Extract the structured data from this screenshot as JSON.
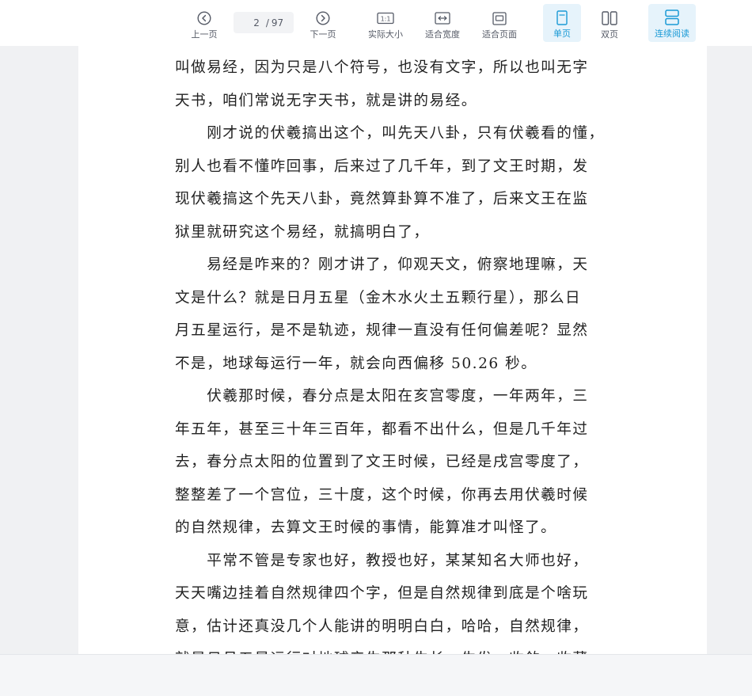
{
  "toolbar": {
    "prev_label": "上一页",
    "next_label": "下一页",
    "current_page": "2",
    "page_separator": "/",
    "total_pages": "97",
    "actual_size_label": "实际大小",
    "actual_size_icon_text": "1:1",
    "fit_width_label": "适合宽度",
    "fit_page_label": "适合页面",
    "single_page_label": "单页",
    "double_page_label": "双页",
    "continuous_label": "连续阅读",
    "accent_color": "#1a9ad6"
  },
  "document": {
    "lines": [
      "叫做易经，因为只是八个符号，也没有文字，所以也叫无字",
      "天书，咱们常说无字天书，就是讲的易经。",
      "　　刚才说的伏羲搞出这个，叫先天八卦，只有伏羲看的懂，",
      "别人也看不懂咋回事，后来过了几千年，到了文王时期，发",
      "现伏羲搞这个先天八卦，竟然算卦算不准了，后来文王在监",
      "狱里就研究这个易经，就搞明白了，",
      "　　易经是咋来的？刚才讲了，仰观天文，俯察地理嘛，天",
      "文是什么？就是日月五星（金木水火土五颗行星），那么日",
      "月五星运行，是不是轨迹，规律一直没有任何偏差呢？显然",
      "不是，地球每运行一年，就会向西偏移 50.26 秒。",
      "　　伏羲那时候，春分点是太阳在亥宫零度，一年两年，三",
      "年五年，甚至三十年三百年，都看不出什么，但是几千年过",
      "去，春分点太阳的位置到了文王时候，已经是戌宫零度了，",
      "整整差了一个宫位，三十度，这个时候，你再去用伏羲时候",
      "的自然规律，去算文王时候的事情，能算准才叫怪了。",
      "　　平常不管是专家也好，教授也好，某某知名大师也好，",
      "天天嘴边挂着自然规律四个字，但是自然规律到底是个啥玩",
      "意，估计还真没几个人能讲的明明白白，哈哈，自然规律，",
      "就是日月五星运行对地球产生那种生长，生发，收敛，收藏"
    ]
  }
}
